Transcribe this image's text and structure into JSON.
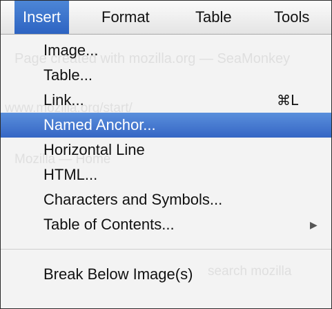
{
  "menubar": {
    "items": [
      {
        "label": "Insert",
        "active": true
      },
      {
        "label": "Format",
        "active": false
      },
      {
        "label": "Table",
        "active": false
      },
      {
        "label": "Tools",
        "active": false
      }
    ]
  },
  "insert_menu": {
    "items": [
      {
        "label": "Image...",
        "shortcut": "",
        "submenu": false
      },
      {
        "label": "Table...",
        "shortcut": "",
        "submenu": false
      },
      {
        "label": "Link...",
        "shortcut": "⌘L",
        "submenu": false
      },
      {
        "label": "Named Anchor...",
        "shortcut": "",
        "submenu": false,
        "highlighted": true
      },
      {
        "label": "Horizontal Line",
        "shortcut": "",
        "submenu": false
      },
      {
        "label": "HTML...",
        "shortcut": "",
        "submenu": false
      },
      {
        "label": "Characters and Symbols...",
        "shortcut": "",
        "submenu": false
      },
      {
        "label": "Table of Contents...",
        "shortcut": "",
        "submenu": true,
        "arrow": "▶"
      },
      {
        "label": "Break Below Image(s)",
        "shortcut": "",
        "submenu": false
      }
    ]
  },
  "background_page": {
    "ghost_lines": [
      "Page created with mozilla.org — SeaMonkey",
      "www.mozilla.org/start/",
      "search mozilla",
      "Mozilla — Home"
    ]
  },
  "colors": {
    "highlight": "#3a6fca",
    "menubar_active": "#2d63c2",
    "menu_background": "#f3f3f3",
    "text": "#111111"
  }
}
